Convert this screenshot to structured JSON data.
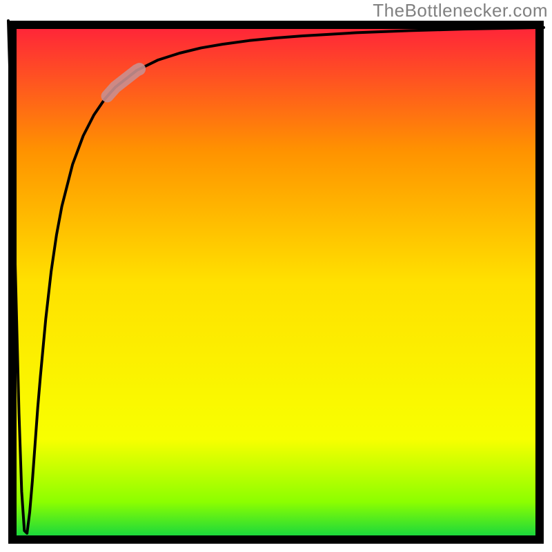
{
  "attribution": "TheBottlenecker.com",
  "chart_data": {
    "type": "line",
    "title": "",
    "xlabel": "",
    "ylabel": "",
    "xlim": [
      0,
      100
    ],
    "ylim": [
      0,
      100
    ],
    "x": [
      0.0,
      0.5,
      1.0,
      1.5,
      2.0,
      2.5,
      3.0,
      3.5,
      4.0,
      4.5,
      5.0,
      5.5,
      6.0,
      7.0,
      8.0,
      9.0,
      10.0,
      12.0,
      14.0,
      16.0,
      18.0,
      20.0,
      24.0,
      28.0,
      32.0,
      36.0,
      40.0,
      45.0,
      50.0,
      55.0,
      60.0,
      65.0,
      70.0,
      75.0,
      80.0,
      85.0,
      90.0,
      95.0,
      100.0
    ],
    "y": [
      100.0,
      83.0,
      65.0,
      45.0,
      25.0,
      10.0,
      2.5,
      2.0,
      6.0,
      12.0,
      19.0,
      26.0,
      32.0,
      43.0,
      52.0,
      59.0,
      64.5,
      72.5,
      78.0,
      82.0,
      85.0,
      87.3,
      90.5,
      92.5,
      93.8,
      94.8,
      95.5,
      96.2,
      96.7,
      97.1,
      97.4,
      97.7,
      97.9,
      98.1,
      98.25,
      98.4,
      98.5,
      98.6,
      98.7
    ],
    "highlight": {
      "x_range": [
        18.5,
        24.5
      ]
    },
    "gradient_stops": [
      {
        "y": 0.0,
        "color": "#00cf4a"
      },
      {
        "y": 8.0,
        "color": "#8cff00"
      },
      {
        "y": 20.0,
        "color": "#f8ff00"
      },
      {
        "y": 50.0,
        "color": "#ffe100"
      },
      {
        "y": 75.0,
        "color": "#ff9300"
      },
      {
        "y": 100.0,
        "color": "#ff1f3c"
      }
    ],
    "border_color": "#000000",
    "line_color": "#000000",
    "highlight_color": "#c98f8f"
  }
}
